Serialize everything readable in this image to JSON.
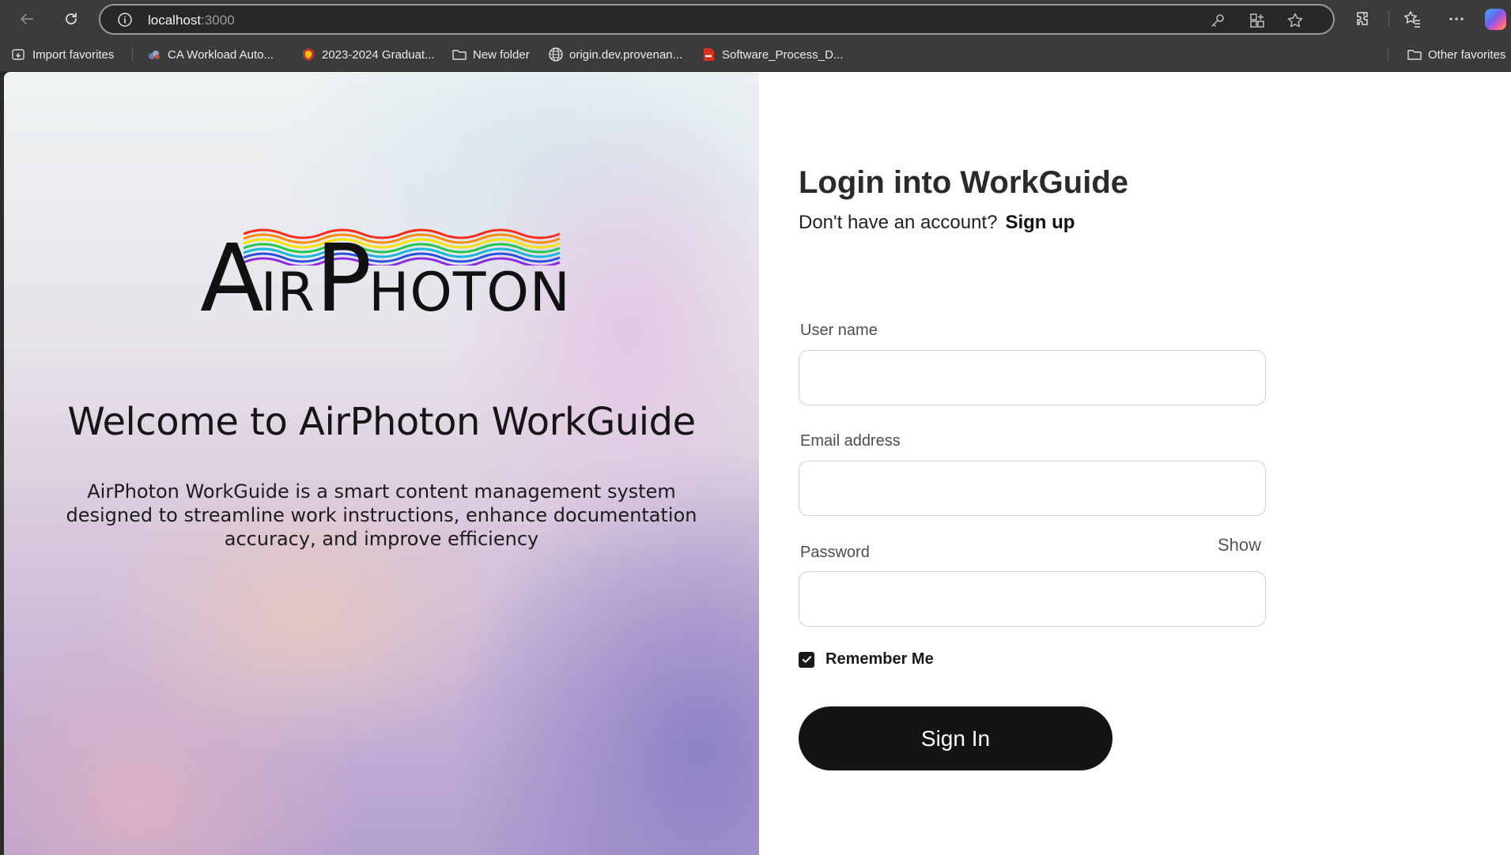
{
  "browser": {
    "url_host": "localhost",
    "url_port": ":3000",
    "bookmarks": [
      {
        "label": "Import favorites",
        "icon": "import-icon"
      },
      {
        "label": "CA Workload Auto...",
        "icon": "ca-workload-icon"
      },
      {
        "label": "2023-2024 Graduat...",
        "icon": "university-shield-icon"
      },
      {
        "label": "New folder",
        "icon": "folder-icon"
      },
      {
        "label": "origin.dev.provenan...",
        "icon": "globe-icon"
      },
      {
        "label": "Software_Process_D...",
        "icon": "pdf-icon"
      }
    ],
    "other_favorites": "Other favorites"
  },
  "hero": {
    "logo_text": "AirPhoton",
    "title": "Welcome to AirPhoton WorkGuide",
    "description": "AirPhoton WorkGuide is a smart content management system designed to streamline work instructions, enhance documentation accuracy, and improve efficiency",
    "colors": [
      "#ff2a1a",
      "#ff8c00",
      "#f5e400",
      "#22c84a",
      "#18b6d8",
      "#2a4fe0",
      "#8a2be2"
    ]
  },
  "login": {
    "title": "Login into WorkGuide",
    "no_account_text": "Don't have an account?",
    "signup_label": "Sign up",
    "username_label": "User name",
    "username_value": "",
    "email_label": "Email address",
    "email_value": "",
    "password_label": "Password",
    "password_value": "",
    "show_label": "Show",
    "remember_label": "Remember Me",
    "remember_checked": true,
    "signin_label": "Sign In"
  }
}
